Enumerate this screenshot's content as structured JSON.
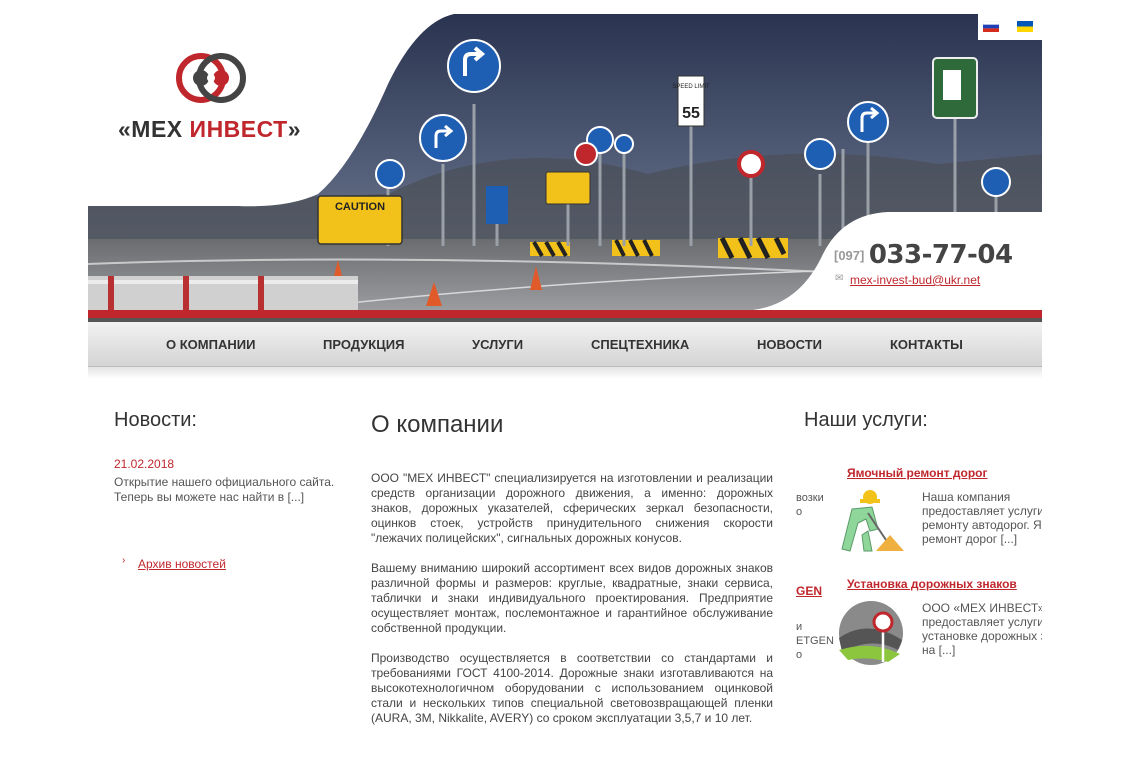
{
  "languages": [
    {
      "code": "ru",
      "colors": [
        "#ffffff",
        "#1f3fb8",
        "#d52b1e"
      ]
    },
    {
      "code": "ua",
      "colors": [
        "#0057b7",
        "#ffd700"
      ]
    }
  ],
  "logo": {
    "quote_open": "«",
    "name_black": "МЕХ",
    "name_red": "ИНВЕСТ",
    "quote_close": "»"
  },
  "contact": {
    "phone_code": "[097]",
    "phone_number": "033-77-04",
    "email": "mex-invest-bud@ukr.net"
  },
  "banner": {
    "sign_text": "CAUTION",
    "speed_top": "SPEED LIMIT",
    "speed_value": "55"
  },
  "nav": [
    "О КОМПАНИИ",
    "ПРОДУКЦИЯ",
    "УСЛУГИ",
    "СПЕЦТЕХНИКА",
    "НОВОСТИ",
    "КОНТАКТЫ"
  ],
  "news": {
    "title": "Новости:",
    "date": "21.02.2018",
    "text": "Открытие нашего официального сайта. Теперь вы можете нас найти в [...]",
    "archive": "Архив новостей"
  },
  "about": {
    "title": "О компании",
    "paragraphs": [
      "ООО \"МЕХ ИНВЕСТ\" специализируется на изготовлении и реализации средств организации дорожного движения, а именно: дорожных знаков, дорожных указателей, сферических зеркал безопасности, оцинков стоек, устройств принудительного снижения скорости \"лежачих полицейских\", сигнальных дорожных конусов.",
      "Вашему вниманию широкий ассортимент всех видов дорожных знаков различной формы и размеров: круглые, квадратные, знаки сервиса, таблички и знаки индивидуального проектирования. Предприятие осуществляет монтаж, послемонтажное и гарантийное обслуживание собственной продукции.",
      "Производство осуществляется в соответствии со стандартами и требованиями ГОСТ 4100-2014. Дорожные знаки изготавливаются на высокотехнологичном оборудовании с использованием оцинковой стали и нескольких типов специальной световозвращающей пленки (AURA, 3M, Nikkalite, AVERY) со сроком эксплуатации 3,5,7 и 10 лет."
    ]
  },
  "services": {
    "title": "Наши услуги:",
    "items": [
      {
        "title": "Ямочный ремонт дорог",
        "lines": [
          "Наша компания",
          "предоставляет услуги",
          "ремонту автодорог. Я",
          "ремонт дорог [...]"
        ],
        "prev_fragments": [
          "возки",
          "о"
        ]
      },
      {
        "title": "Установка дорожных знаков",
        "lines": [
          "ООО «МЕХ ИНВЕСТ»",
          "предоставляет услуги",
          "установке дорожных з",
          "на [...]"
        ],
        "prev_title_fragment": "GEN",
        "prev_fragments": [
          "и",
          "ETGEN",
          "о"
        ]
      }
    ]
  },
  "colors": {
    "accent": "#c0272d",
    "sign_blue": "#1e5fb4",
    "sign_yellow": "#f2c21b",
    "sky": "#3a4660"
  }
}
